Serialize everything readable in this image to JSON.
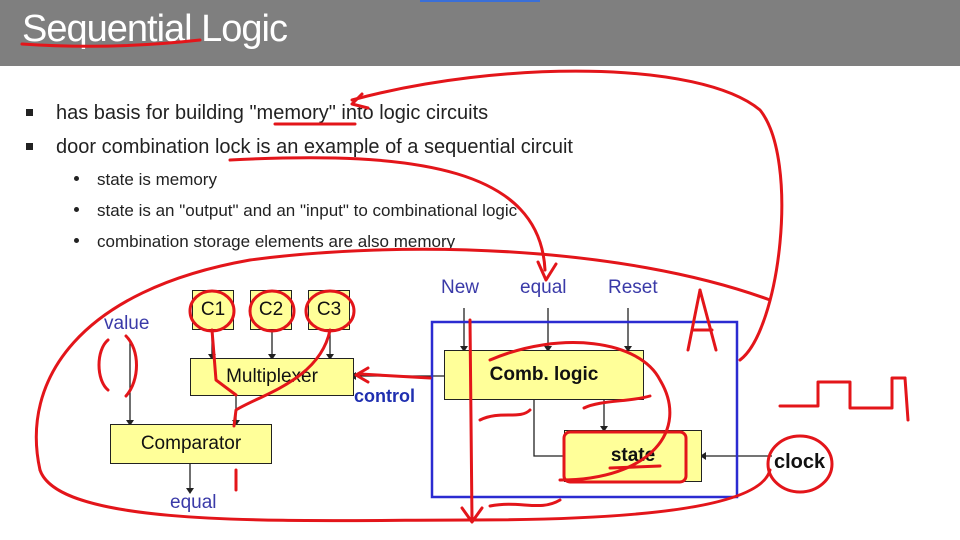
{
  "slide": {
    "title": "Sequential Logic",
    "bullets": [
      {
        "text": "has basis for building \"memory\" into logic circuits"
      },
      {
        "text": "door combination lock is an example of a sequential circuit"
      }
    ],
    "sub_bullets": [
      {
        "text": "state is memory"
      },
      {
        "text": "state is an \"output\" and an \"input\" to combinational logic"
      },
      {
        "text": "combination storage elements are also memory"
      }
    ]
  },
  "diagram": {
    "c1": "C1",
    "c2": "C2",
    "c3": "C3",
    "value": "value",
    "multiplexer": "Multiplexer",
    "comparator": "Comparator",
    "equal_out": "equal",
    "control": "control",
    "new": "New",
    "equal_in": "equal",
    "reset": "Reset",
    "comb_logic": "Comb. logic",
    "state": "state",
    "clock": "clock"
  },
  "colors": {
    "title_bar": "#7f7f7f",
    "box_fill": "#ffff99",
    "label_blue": "#3a3aa8",
    "ink_red": "#e3151a",
    "frame_blue": "#2b2bd1"
  }
}
